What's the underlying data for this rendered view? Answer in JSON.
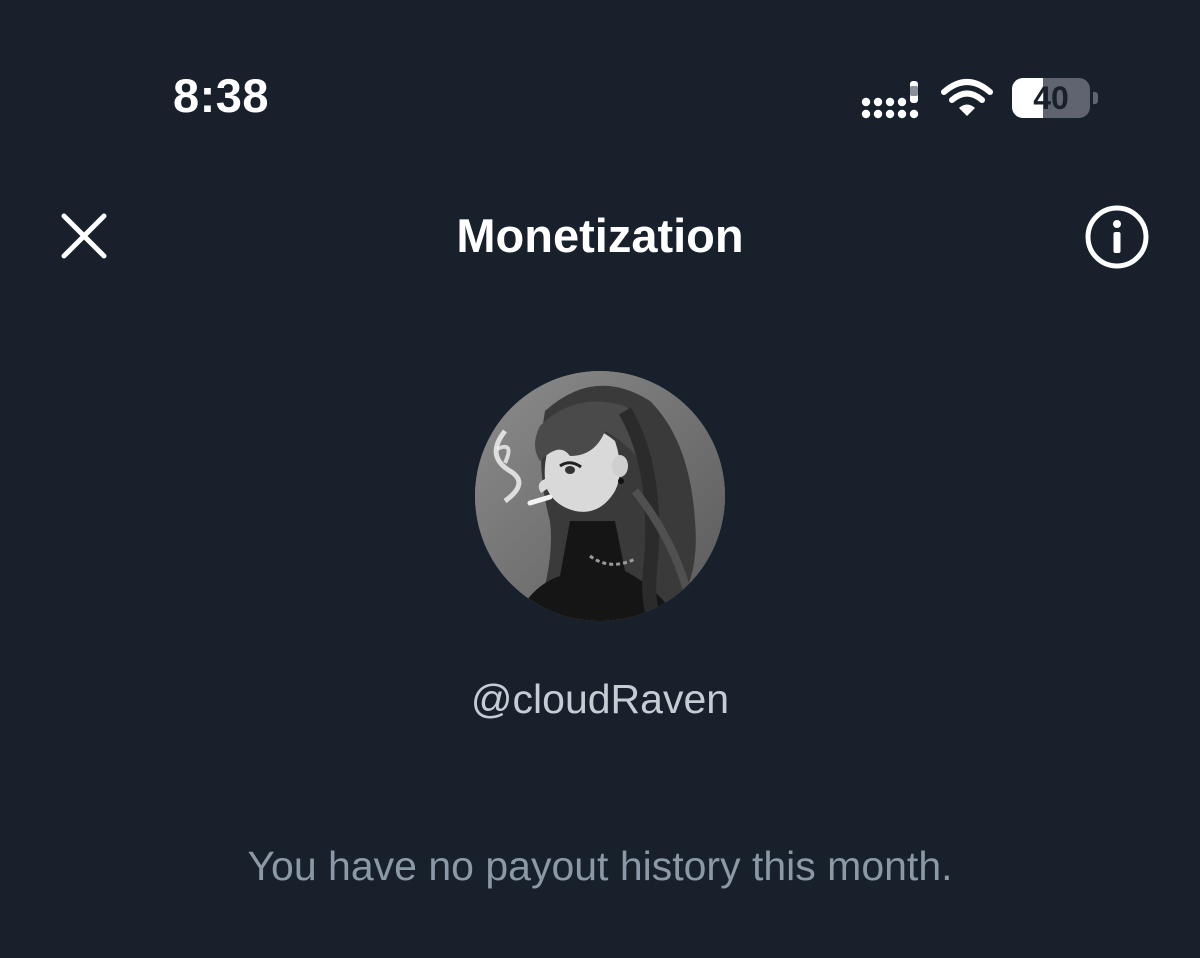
{
  "status_bar": {
    "time": "8:38",
    "battery_level": "40",
    "battery_fraction": 0.4,
    "icons": [
      "cellular-signal-icon",
      "wifi-icon",
      "battery-icon"
    ]
  },
  "header": {
    "title": "Monetization",
    "close_icon": "close-icon",
    "info_icon": "info-icon"
  },
  "profile": {
    "handle": "@cloudRaven",
    "avatar_icon": "avatar"
  },
  "payouts": {
    "empty_message": "You have no payout history this month."
  },
  "colors": {
    "background": "#17202b",
    "primary_text": "#ffffff",
    "secondary_text": "#8b98a5",
    "handle_text": "#c6ccd3"
  }
}
